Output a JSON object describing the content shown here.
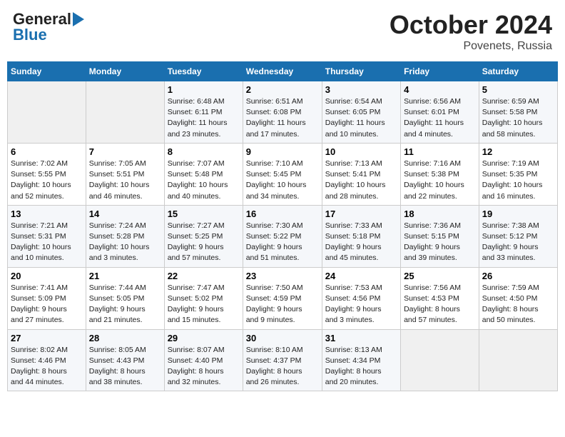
{
  "header": {
    "logo_line1": "General",
    "logo_line2": "Blue",
    "month": "October 2024",
    "location": "Povenets, Russia"
  },
  "days_of_week": [
    "Sunday",
    "Monday",
    "Tuesday",
    "Wednesday",
    "Thursday",
    "Friday",
    "Saturday"
  ],
  "weeks": [
    [
      {
        "day": "",
        "text": ""
      },
      {
        "day": "",
        "text": ""
      },
      {
        "day": "1",
        "text": "Sunrise: 6:48 AM\nSunset: 6:11 PM\nDaylight: 11 hours\nand 23 minutes."
      },
      {
        "day": "2",
        "text": "Sunrise: 6:51 AM\nSunset: 6:08 PM\nDaylight: 11 hours\nand 17 minutes."
      },
      {
        "day": "3",
        "text": "Sunrise: 6:54 AM\nSunset: 6:05 PM\nDaylight: 11 hours\nand 10 minutes."
      },
      {
        "day": "4",
        "text": "Sunrise: 6:56 AM\nSunset: 6:01 PM\nDaylight: 11 hours\nand 4 minutes."
      },
      {
        "day": "5",
        "text": "Sunrise: 6:59 AM\nSunset: 5:58 PM\nDaylight: 10 hours\nand 58 minutes."
      }
    ],
    [
      {
        "day": "6",
        "text": "Sunrise: 7:02 AM\nSunset: 5:55 PM\nDaylight: 10 hours\nand 52 minutes."
      },
      {
        "day": "7",
        "text": "Sunrise: 7:05 AM\nSunset: 5:51 PM\nDaylight: 10 hours\nand 46 minutes."
      },
      {
        "day": "8",
        "text": "Sunrise: 7:07 AM\nSunset: 5:48 PM\nDaylight: 10 hours\nand 40 minutes."
      },
      {
        "day": "9",
        "text": "Sunrise: 7:10 AM\nSunset: 5:45 PM\nDaylight: 10 hours\nand 34 minutes."
      },
      {
        "day": "10",
        "text": "Sunrise: 7:13 AM\nSunset: 5:41 PM\nDaylight: 10 hours\nand 28 minutes."
      },
      {
        "day": "11",
        "text": "Sunrise: 7:16 AM\nSunset: 5:38 PM\nDaylight: 10 hours\nand 22 minutes."
      },
      {
        "day": "12",
        "text": "Sunrise: 7:19 AM\nSunset: 5:35 PM\nDaylight: 10 hours\nand 16 minutes."
      }
    ],
    [
      {
        "day": "13",
        "text": "Sunrise: 7:21 AM\nSunset: 5:31 PM\nDaylight: 10 hours\nand 10 minutes."
      },
      {
        "day": "14",
        "text": "Sunrise: 7:24 AM\nSunset: 5:28 PM\nDaylight: 10 hours\nand 3 minutes."
      },
      {
        "day": "15",
        "text": "Sunrise: 7:27 AM\nSunset: 5:25 PM\nDaylight: 9 hours\nand 57 minutes."
      },
      {
        "day": "16",
        "text": "Sunrise: 7:30 AM\nSunset: 5:22 PM\nDaylight: 9 hours\nand 51 minutes."
      },
      {
        "day": "17",
        "text": "Sunrise: 7:33 AM\nSunset: 5:18 PM\nDaylight: 9 hours\nand 45 minutes."
      },
      {
        "day": "18",
        "text": "Sunrise: 7:36 AM\nSunset: 5:15 PM\nDaylight: 9 hours\nand 39 minutes."
      },
      {
        "day": "19",
        "text": "Sunrise: 7:38 AM\nSunset: 5:12 PM\nDaylight: 9 hours\nand 33 minutes."
      }
    ],
    [
      {
        "day": "20",
        "text": "Sunrise: 7:41 AM\nSunset: 5:09 PM\nDaylight: 9 hours\nand 27 minutes."
      },
      {
        "day": "21",
        "text": "Sunrise: 7:44 AM\nSunset: 5:05 PM\nDaylight: 9 hours\nand 21 minutes."
      },
      {
        "day": "22",
        "text": "Sunrise: 7:47 AM\nSunset: 5:02 PM\nDaylight: 9 hours\nand 15 minutes."
      },
      {
        "day": "23",
        "text": "Sunrise: 7:50 AM\nSunset: 4:59 PM\nDaylight: 9 hours\nand 9 minutes."
      },
      {
        "day": "24",
        "text": "Sunrise: 7:53 AM\nSunset: 4:56 PM\nDaylight: 9 hours\nand 3 minutes."
      },
      {
        "day": "25",
        "text": "Sunrise: 7:56 AM\nSunset: 4:53 PM\nDaylight: 8 hours\nand 57 minutes."
      },
      {
        "day": "26",
        "text": "Sunrise: 7:59 AM\nSunset: 4:50 PM\nDaylight: 8 hours\nand 50 minutes."
      }
    ],
    [
      {
        "day": "27",
        "text": "Sunrise: 8:02 AM\nSunset: 4:46 PM\nDaylight: 8 hours\nand 44 minutes."
      },
      {
        "day": "28",
        "text": "Sunrise: 8:05 AM\nSunset: 4:43 PM\nDaylight: 8 hours\nand 38 minutes."
      },
      {
        "day": "29",
        "text": "Sunrise: 8:07 AM\nSunset: 4:40 PM\nDaylight: 8 hours\nand 32 minutes."
      },
      {
        "day": "30",
        "text": "Sunrise: 8:10 AM\nSunset: 4:37 PM\nDaylight: 8 hours\nand 26 minutes."
      },
      {
        "day": "31",
        "text": "Sunrise: 8:13 AM\nSunset: 4:34 PM\nDaylight: 8 hours\nand 20 minutes."
      },
      {
        "day": "",
        "text": ""
      },
      {
        "day": "",
        "text": ""
      }
    ]
  ]
}
